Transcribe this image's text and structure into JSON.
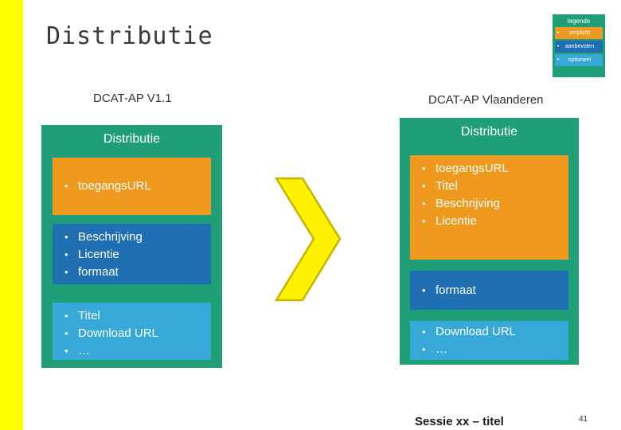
{
  "slide": {
    "title": "Distributie",
    "footer_text": "Sessie xx – titel",
    "page_number": "41"
  },
  "legend": {
    "title": "legende",
    "items": [
      {
        "label": "verplicht",
        "bullet": "•",
        "color": "#EF9A1E"
      },
      {
        "label": "aanbevolen",
        "bullet": "•",
        "color": "#1F6FB2"
      },
      {
        "label": "optioneel",
        "bullet": "•",
        "color": "#36A9D8"
      }
    ]
  },
  "colors": {
    "accent_stripe": "#FFFF00",
    "container_green": "#1F9E78",
    "required_orange": "#EF9A1E",
    "recommended_blue": "#1F6FB2",
    "optional_lightblue": "#36A9D8",
    "arrow_yellow": "#FFF200",
    "arrow_outline": "#C8B400"
  },
  "columns": {
    "left": {
      "header": "DCAT-AP V1.1",
      "container_title": "Distributie",
      "blocks": [
        {
          "level": "required",
          "items": [
            {
              "bullet": "•",
              "label": "toegangsURL"
            }
          ]
        },
        {
          "level": "recommended",
          "items": [
            {
              "bullet": "•",
              "label": "Beschrijving"
            },
            {
              "bullet": "•",
              "label": "Licentie"
            },
            {
              "bullet": "•",
              "label": "formaat"
            }
          ]
        },
        {
          "level": "optional",
          "items": [
            {
              "bullet": "•",
              "label": "Titel"
            },
            {
              "bullet": "•",
              "label": "Download URL"
            },
            {
              "bullet": "•",
              "label": "…"
            }
          ]
        }
      ]
    },
    "right": {
      "header": "DCAT-AP Vlaanderen",
      "container_title": "Distributie",
      "blocks": [
        {
          "level": "required",
          "items": [
            {
              "bullet": "•",
              "label": "toegangsURL"
            },
            {
              "bullet": "•",
              "label": "Titel"
            },
            {
              "bullet": "•",
              "label": "Beschrijving"
            },
            {
              "bullet": "•",
              "label": "Licentie"
            }
          ]
        },
        {
          "level": "recommended",
          "items": [
            {
              "bullet": "•",
              "label": "formaat"
            }
          ]
        },
        {
          "level": "optional",
          "items": [
            {
              "bullet": "•",
              "label": "Download URL"
            },
            {
              "bullet": "•",
              "label": "…"
            }
          ]
        }
      ]
    }
  },
  "arrow": {
    "name": "chevron-right-arrow"
  }
}
